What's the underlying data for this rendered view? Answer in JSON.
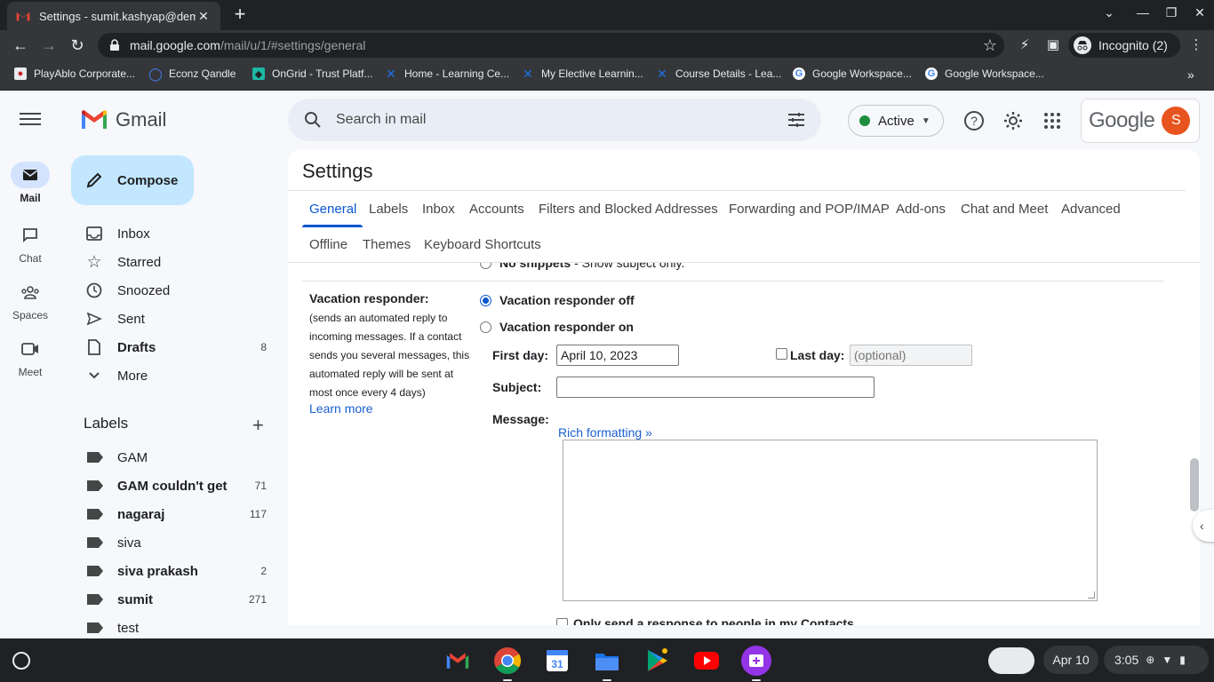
{
  "browser": {
    "tab_title": "Settings - sumit.kashyap@demo",
    "url_host": "mail.google.com",
    "url_path": "/mail/u/1/#settings/general",
    "profile_label": "Incognito (2)",
    "bookmarks": [
      {
        "label": "PlayAblo Corporate...",
        "icon": "playablo-icon"
      },
      {
        "label": "Econz Qandle",
        "icon": "qandle-icon"
      },
      {
        "label": "OnGrid - Trust Platf...",
        "icon": "ongrid-icon"
      },
      {
        "label": "Home - Learning Ce...",
        "icon": "x-logo-icon"
      },
      {
        "label": "My Elective Learnin...",
        "icon": "x-logo-icon"
      },
      {
        "label": "Course Details - Lea...",
        "icon": "x-logo-icon"
      },
      {
        "label": "Google Workspace...",
        "icon": "google-icon"
      },
      {
        "label": "Google Workspace...",
        "icon": "google-icon"
      }
    ]
  },
  "gmail": {
    "brand": "Gmail",
    "search_placeholder": "Search in mail",
    "status": "Active",
    "account_brand": "Google",
    "avatar_letter": "S",
    "rail": [
      {
        "label": "Mail",
        "icon": "mail-icon"
      },
      {
        "label": "Chat",
        "icon": "chat-icon"
      },
      {
        "label": "Spaces",
        "icon": "spaces-icon"
      },
      {
        "label": "Meet",
        "icon": "meet-icon"
      }
    ],
    "compose_label": "Compose",
    "nav": [
      {
        "label": "Inbox",
        "count": "",
        "icon": "inbox-icon"
      },
      {
        "label": "Starred",
        "count": "",
        "icon": "star-icon"
      },
      {
        "label": "Snoozed",
        "count": "",
        "icon": "clock-icon"
      },
      {
        "label": "Sent",
        "count": "",
        "icon": "send-icon"
      },
      {
        "label": "Drafts",
        "count": "8",
        "icon": "draft-icon"
      },
      {
        "label": "More",
        "count": "",
        "icon": "chevron-down-icon"
      }
    ],
    "labels_heading": "Labels",
    "labels": [
      {
        "label": "GAM",
        "count": ""
      },
      {
        "label": "GAM couldn't get",
        "count": "71"
      },
      {
        "label": "nagaraj",
        "count": "117"
      },
      {
        "label": "siva",
        "count": ""
      },
      {
        "label": "siva prakash",
        "count": "2"
      },
      {
        "label": "sumit",
        "count": "271"
      },
      {
        "label": "test",
        "count": ""
      }
    ]
  },
  "settings": {
    "title": "Settings",
    "tabs_row1": [
      "General",
      "Labels",
      "Inbox",
      "Accounts",
      "Filters and Blocked Addresses",
      "Forwarding and POP/IMAP",
      "Add-ons",
      "Chat and Meet",
      "Advanced"
    ],
    "tabs_row2": [
      "Offline",
      "Themes",
      "Keyboard Shortcuts"
    ],
    "snippet_bold": "No snippets",
    "snippet_rest": "- Show subject only.",
    "vacation_heading": "Vacation responder:",
    "vacation_desc": "(sends an automated reply to incoming messages. If a contact sends you several messages, this automated reply will be sent at most once every 4 days)",
    "learn_more": "Learn more",
    "off_label": "Vacation responder off",
    "on_label": "Vacation responder on",
    "first_day_label": "First day:",
    "first_day_value": "April 10, 2023",
    "last_day_label": "Last day:",
    "last_day_placeholder": "(optional)",
    "subject_label": "Subject:",
    "message_label": "Message:",
    "rich_formatting": "Rich formatting »",
    "only_contacts": "Only send a response to people in my Contacts"
  },
  "shelf": {
    "date": "Apr 10",
    "time": "3:05",
    "apps": [
      "gmail-app-icon",
      "chrome-app-icon",
      "calendar-app-icon",
      "files-app-icon",
      "play-store-app-icon",
      "youtube-app-icon",
      "screencast-app-icon"
    ]
  }
}
